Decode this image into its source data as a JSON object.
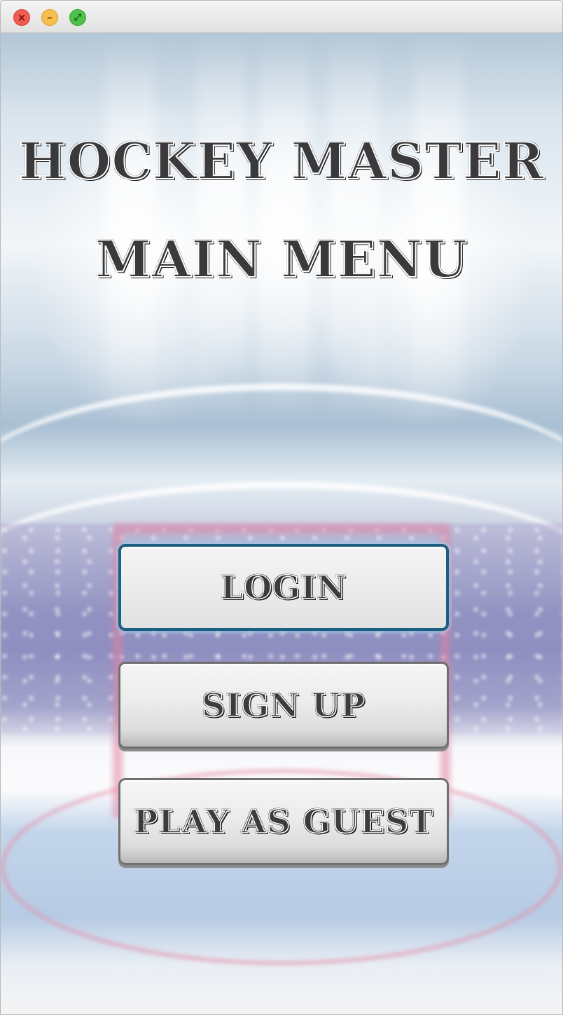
{
  "window": {
    "controls": {
      "close_icon": "×",
      "minimize_icon": "–",
      "maximize_icon": "⤢"
    }
  },
  "header": {
    "app_title": "HOCKEY MASTER",
    "menu_title": "MAIN MENU"
  },
  "menu": {
    "items": [
      {
        "label": "LOGIN",
        "focused": true
      },
      {
        "label": "SIGN UP",
        "focused": false
      },
      {
        "label": "PLAY AS GUEST",
        "focused": false
      }
    ]
  },
  "colors": {
    "focus_border": "#1d5f80",
    "title_fill": "#3a3a3c",
    "goal_red": "#e282a0"
  }
}
